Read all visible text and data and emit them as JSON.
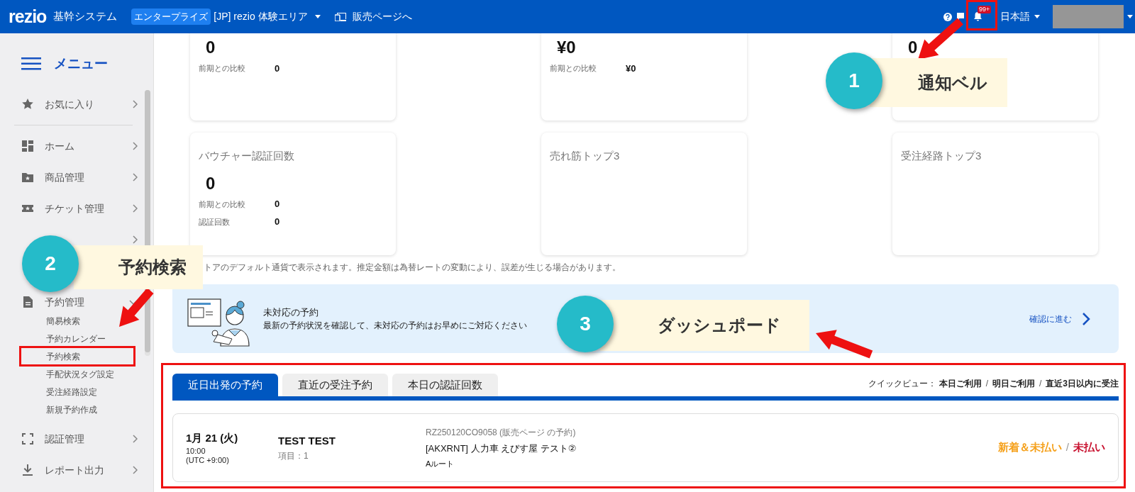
{
  "header": {
    "logo": "rezio",
    "system_name": "基幹システム",
    "plan_badge": "エンタープライズ",
    "workspace": "[JP] rezio 体験エリア",
    "sales_page_link": "販売ページへ",
    "notification_count": "99+",
    "language": "日本語"
  },
  "sidebar": {
    "title": "メニュー",
    "items": [
      {
        "label": "お気に入り",
        "expanded": false
      },
      {
        "label": "ホーム",
        "expanded": false
      },
      {
        "label": "商品管理",
        "expanded": false
      },
      {
        "label": "チケット管理",
        "expanded": false
      },
      {
        "expanded": false
      },
      {
        "label": "予約管理",
        "expanded": true,
        "children": [
          {
            "label": "簡易検索"
          },
          {
            "label": "予約カレンダー"
          },
          {
            "label": "予約検索"
          },
          {
            "label": "手配状況タグ設定"
          },
          {
            "label": "受注経路設定"
          },
          {
            "label": "新規予約作成"
          }
        ]
      },
      {
        "label": "認証管理",
        "expanded": false
      },
      {
        "label": "レポート出力",
        "expanded": false
      }
    ]
  },
  "stat_cards": [
    {
      "value": "0",
      "rows": [
        {
          "label": "前期との比較",
          "value": "0"
        }
      ]
    },
    {
      "value": "¥0",
      "rows": [
        {
          "label": "前期との比較",
          "value": "¥0"
        }
      ]
    },
    {
      "value": "0"
    },
    {
      "title": "バウチャー認証回数",
      "value": "0",
      "rows": [
        {
          "label": "前期との比較",
          "value": "0"
        },
        {
          "label": "認証回数",
          "value": "0"
        }
      ]
    },
    {
      "title": "売れ筋トップ3"
    },
    {
      "title": "受注経路トップ3"
    }
  ],
  "currency_note": "トアのデフォルト通貨で表示されます。推定金額は為替レートの変動により、誤差が生じる場合があります。",
  "pending_banner": {
    "title": "未対応の予約",
    "description": "最新の予約状況を確認して、未対応の予約はお早めにご対応ください",
    "link": "確認に進む"
  },
  "tabs": [
    {
      "label": "近日出発の予約",
      "selected": true
    },
    {
      "label": "直近の受注予約",
      "selected": false
    },
    {
      "label": "本日の認証回数",
      "selected": false
    }
  ],
  "quick_view": {
    "label": "クイックビュー：",
    "links": [
      "本日ご利用",
      "明日ご利用",
      "直近3日以内に受注"
    ],
    "separators": [
      "/",
      "/"
    ]
  },
  "reservations": [
    {
      "date": "1月 21 (火)",
      "time": "10:00",
      "timezone": "(UTC +9:00)",
      "customer": "TEST TEST",
      "items": "項目：1",
      "reference": "RZ250120CO9058 (販売ページ の予約)",
      "product": "[AKXRNT] 人力車 えびす屋 テスト②",
      "plan": "Aルート",
      "statuses": [
        {
          "label": "新着＆未払い",
          "color": "#f5a01a"
        },
        {
          "label": "未払い",
          "color": "#c8102e"
        }
      ],
      "separator": "/"
    }
  ],
  "annotations": [
    {
      "number": "1",
      "label": "通知ベル"
    },
    {
      "number": "2",
      "label": "予約検索"
    },
    {
      "number": "3",
      "label": "ダッシュポード"
    }
  ]
}
